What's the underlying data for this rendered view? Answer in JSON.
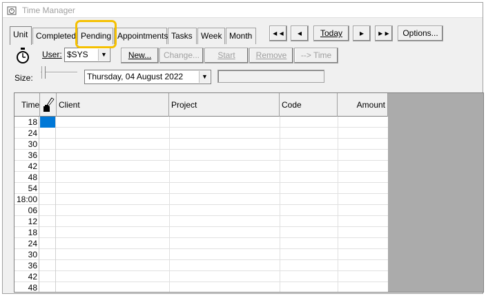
{
  "window": {
    "title": "Time Manager"
  },
  "tabs": [
    "Unit",
    "Completed",
    "Pending",
    "Appointments",
    "Tasks",
    "Week",
    "Month"
  ],
  "active_tab": "Unit",
  "highlighted_tab": "Pending",
  "nav": {
    "first": "◂ ◂",
    "prev": "◂",
    "today": "Today",
    "next": "▸",
    "last": "▸ ▸",
    "options": "Options..."
  },
  "toolbar": {
    "user_label": "User:",
    "user_value": "$SYS",
    "new_label": "New...",
    "change_label": "Change...",
    "start_label": "Start",
    "remove_label": "Remove",
    "to_time_label": "--> Time",
    "size_label": "Size:",
    "date_value": "Thursday, 04 August 2022"
  },
  "grid": {
    "columns": [
      "Time",
      "Client",
      "Project",
      "Code",
      "Amount"
    ],
    "time_rows": [
      "18",
      "24",
      "30",
      "36",
      "42",
      "48",
      "54",
      "18:00",
      "06",
      "12",
      "18",
      "24",
      "30",
      "36",
      "42",
      "48"
    ]
  },
  "colors": {
    "highlight": "#f5c000",
    "selection": "#0078d7",
    "empty_area": "#ababab"
  }
}
